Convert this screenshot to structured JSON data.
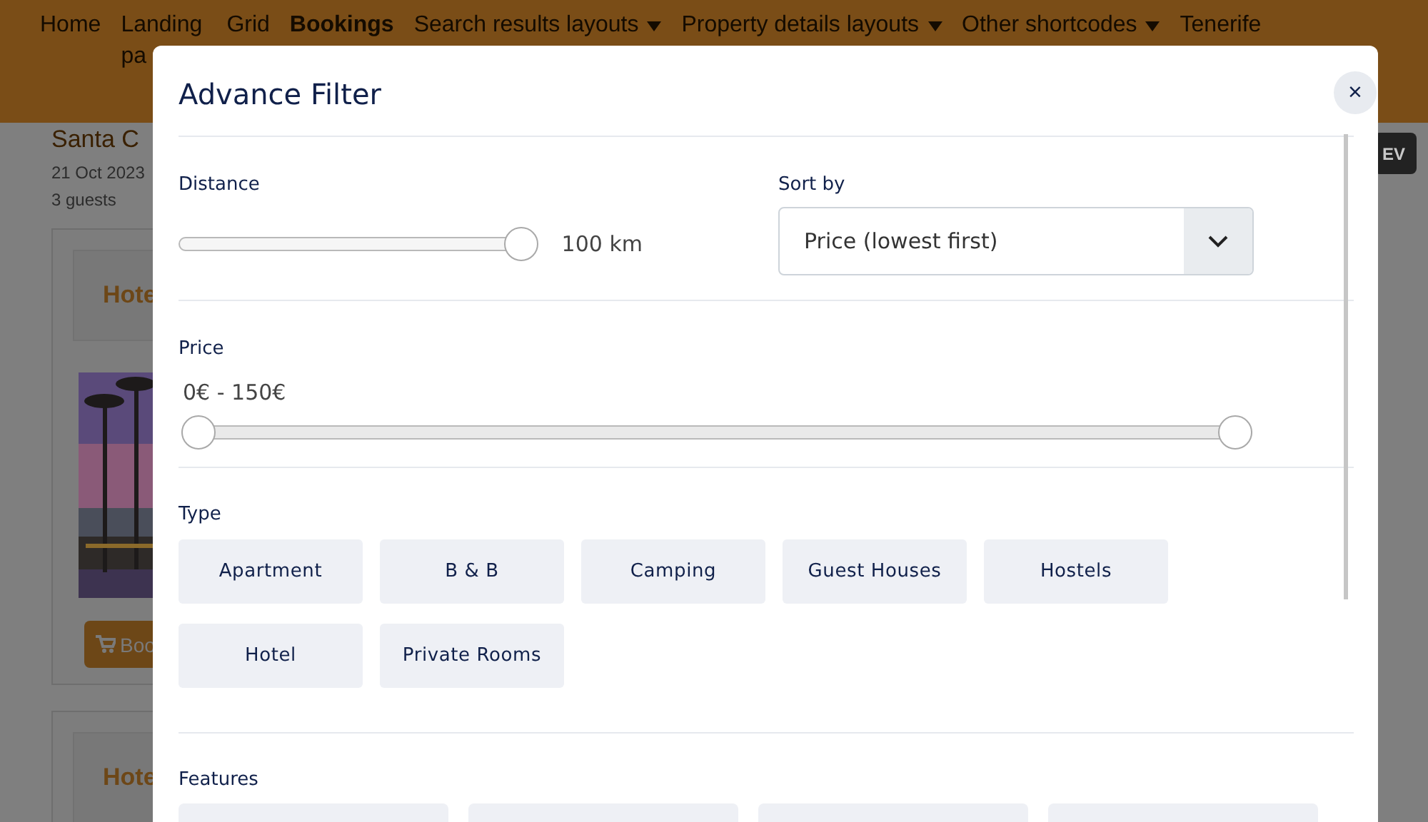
{
  "nav": {
    "items": [
      {
        "label": "Home"
      },
      {
        "label": "Landing pa"
      },
      {
        "label": "Grid"
      },
      {
        "label": "Bookings",
        "selected": true
      },
      {
        "label": "Search results layouts",
        "dropdown": true
      },
      {
        "label": "Property details layouts",
        "dropdown": true
      },
      {
        "label": "Other shortcodes",
        "dropdown": true
      },
      {
        "label": "Tenerife"
      }
    ]
  },
  "booking": {
    "title": "Santa C",
    "date": "21 Oct 2023",
    "guests": "3 guests",
    "action": "EV"
  },
  "cards": [
    {
      "title": "Hote",
      "button": "Boo"
    },
    {
      "title": "Hote"
    }
  ],
  "modal": {
    "title": "Advance Filter",
    "close": "×",
    "distance": {
      "label": "Distance",
      "level": 1,
      "reading": "100 km"
    },
    "sort": {
      "label": "Sort by",
      "value": "Price (lowest first)"
    },
    "price": {
      "label": "Price",
      "reading": "0€ - 150€",
      "low": {
        "level": 0
      },
      "high": {
        "level": 1
      }
    },
    "type": {
      "label": "Type",
      "options": [
        {
          "label": "Apartment",
          "selected": false
        },
        {
          "label": "B & B",
          "selected": false
        },
        {
          "label": "Camping",
          "selected": false
        },
        {
          "label": "Guest Houses",
          "selected": false
        },
        {
          "label": "Hostels",
          "selected": false
        },
        {
          "label": "Hotel",
          "selected": false
        },
        {
          "label": "Private Rooms",
          "selected": false
        }
      ]
    },
    "features": {
      "label": "Features",
      "options": [
        {
          "kind": "chip"
        },
        {
          "kind": "chip"
        },
        {
          "kind": "chip"
        },
        {
          "kind": "chip"
        }
      ]
    }
  }
}
